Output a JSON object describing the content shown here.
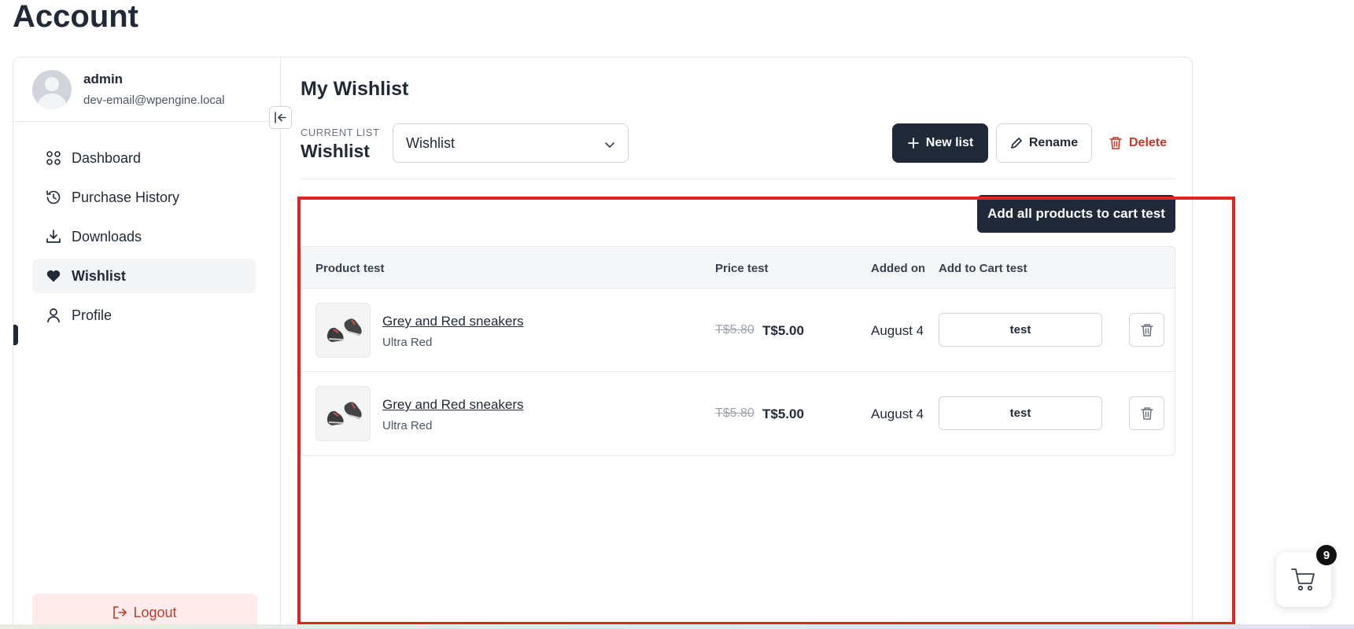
{
  "page": {
    "title": "Account"
  },
  "user": {
    "name": "admin",
    "email": "dev-email@wpengine.local"
  },
  "nav": {
    "items": [
      {
        "label": "Dashboard",
        "icon": "grid-icon",
        "active": false
      },
      {
        "label": "Purchase History",
        "icon": "history-icon",
        "active": false
      },
      {
        "label": "Downloads",
        "icon": "download-icon",
        "active": false
      },
      {
        "label": "Wishlist",
        "icon": "heart-icon",
        "active": true
      },
      {
        "label": "Profile",
        "icon": "user-icon",
        "active": false
      }
    ],
    "logout_label": "Logout"
  },
  "wishlist": {
    "title": "My Wishlist",
    "current_label": "CURRENT LIST",
    "current_value": "Wishlist",
    "selected_list": "Wishlist",
    "new_list_label": "New list",
    "rename_label": "Rename",
    "delete_label": "Delete",
    "add_all_label": "Add all products to cart test",
    "columns": [
      "Product test",
      "Price test",
      "Added on",
      "Add to Cart test"
    ],
    "rows": [
      {
        "name": "Grey and Red sneakers",
        "variant": "Ultra Red",
        "old_price": "T$5.80",
        "price": "T$5.00",
        "added_on": "August 4",
        "cart_label": "test"
      },
      {
        "name": "Grey and Red sneakers",
        "variant": "Ultra Red",
        "old_price": "T$5.80",
        "price": "T$5.00",
        "added_on": "August 4",
        "cart_label": "test"
      }
    ]
  },
  "cart": {
    "count": "9"
  },
  "colors": {
    "primary": "#1f2937",
    "danger": "#c0392b",
    "highlight": "#e02424"
  }
}
